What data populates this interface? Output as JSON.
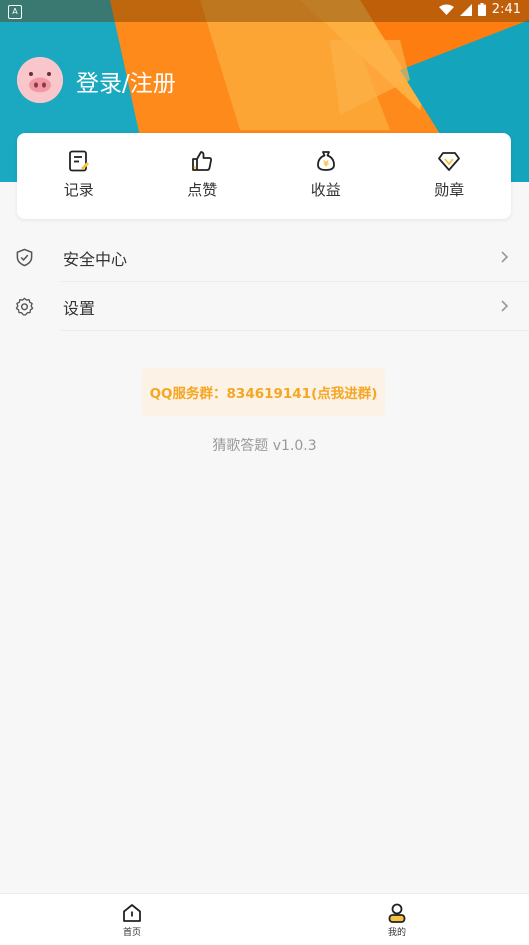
{
  "status_bar": {
    "time": "2:41",
    "app_badge": "A"
  },
  "header": {
    "login_text": "登录/注册"
  },
  "quick_actions": [
    {
      "label": "记录",
      "icon": "record-icon"
    },
    {
      "label": "点赞",
      "icon": "thumb-up-icon"
    },
    {
      "label": "收益",
      "icon": "money-bag-icon"
    },
    {
      "label": "勋章",
      "icon": "diamond-icon"
    }
  ],
  "menu": [
    {
      "label": "安全中心",
      "icon": "shield-icon"
    },
    {
      "label": "设置",
      "icon": "gear-icon"
    }
  ],
  "qq_group": "QQ服务群：834619141(点我进群)",
  "version": "猜歌答题 v1.0.3",
  "tabs": [
    {
      "label": "首页",
      "icon": "home-icon"
    },
    {
      "label": "我的",
      "icon": "profile-icon"
    }
  ],
  "colors": {
    "accent_orange": "#f5a623",
    "header_orange": "#fd8a1a",
    "teal": "#1aa9c1"
  }
}
